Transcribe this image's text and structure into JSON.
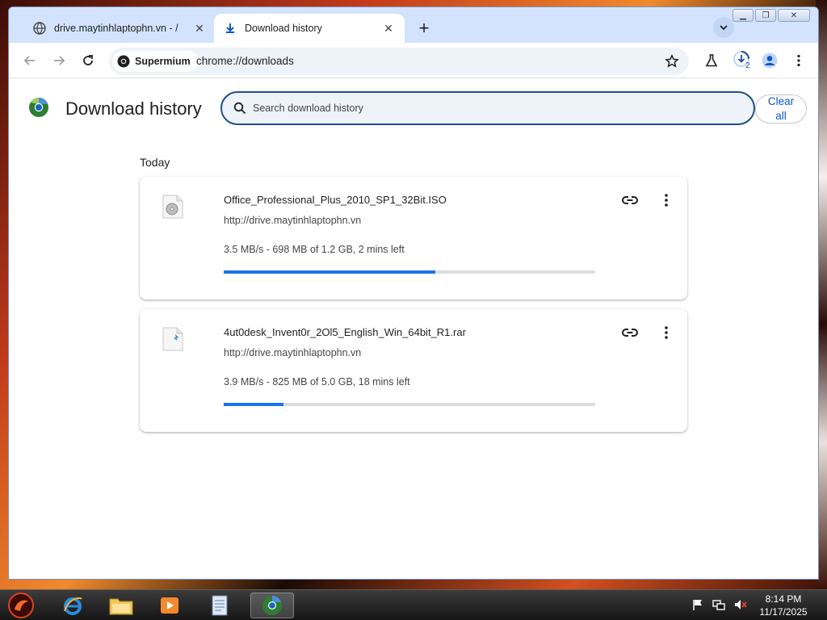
{
  "tabs": [
    {
      "title": "drive.maytinhlaptophn.vn - /",
      "icon": "globe-icon"
    },
    {
      "title": "Download history",
      "icon": "download-icon",
      "active": true
    }
  ],
  "toolbar": {
    "site_chip": "Supermium",
    "url": "chrome://downloads",
    "download_badge": "2"
  },
  "page": {
    "title": "Download history",
    "search_placeholder": "Search download history",
    "clear_all": "Clear all",
    "section_date": "Today"
  },
  "downloads": [
    {
      "filename": "Office_Professional_Plus_2010_SP1_32Bit.ISO",
      "url": "http://drive.maytinhlaptophn.vn",
      "status": "3.5 MB/s - 698 MB of 1.2 GB, 2 mins left",
      "progress": 0.57
    },
    {
      "filename": "4ut0desk_Invent0r_2Ol5_English_Win_64bit_R1.rar",
      "url": "http://drive.maytinhlaptophn.vn",
      "status": "3.9 MB/s - 825 MB of 5.0 GB, 18 mins left",
      "progress": 0.16
    }
  ],
  "taskbar": {
    "time": "8:14 PM",
    "date": "11/17/2025"
  },
  "colors": {
    "accent": "#1a73e8",
    "search_border": "#1f4f86",
    "tabstrip": "#d3e3fd"
  }
}
